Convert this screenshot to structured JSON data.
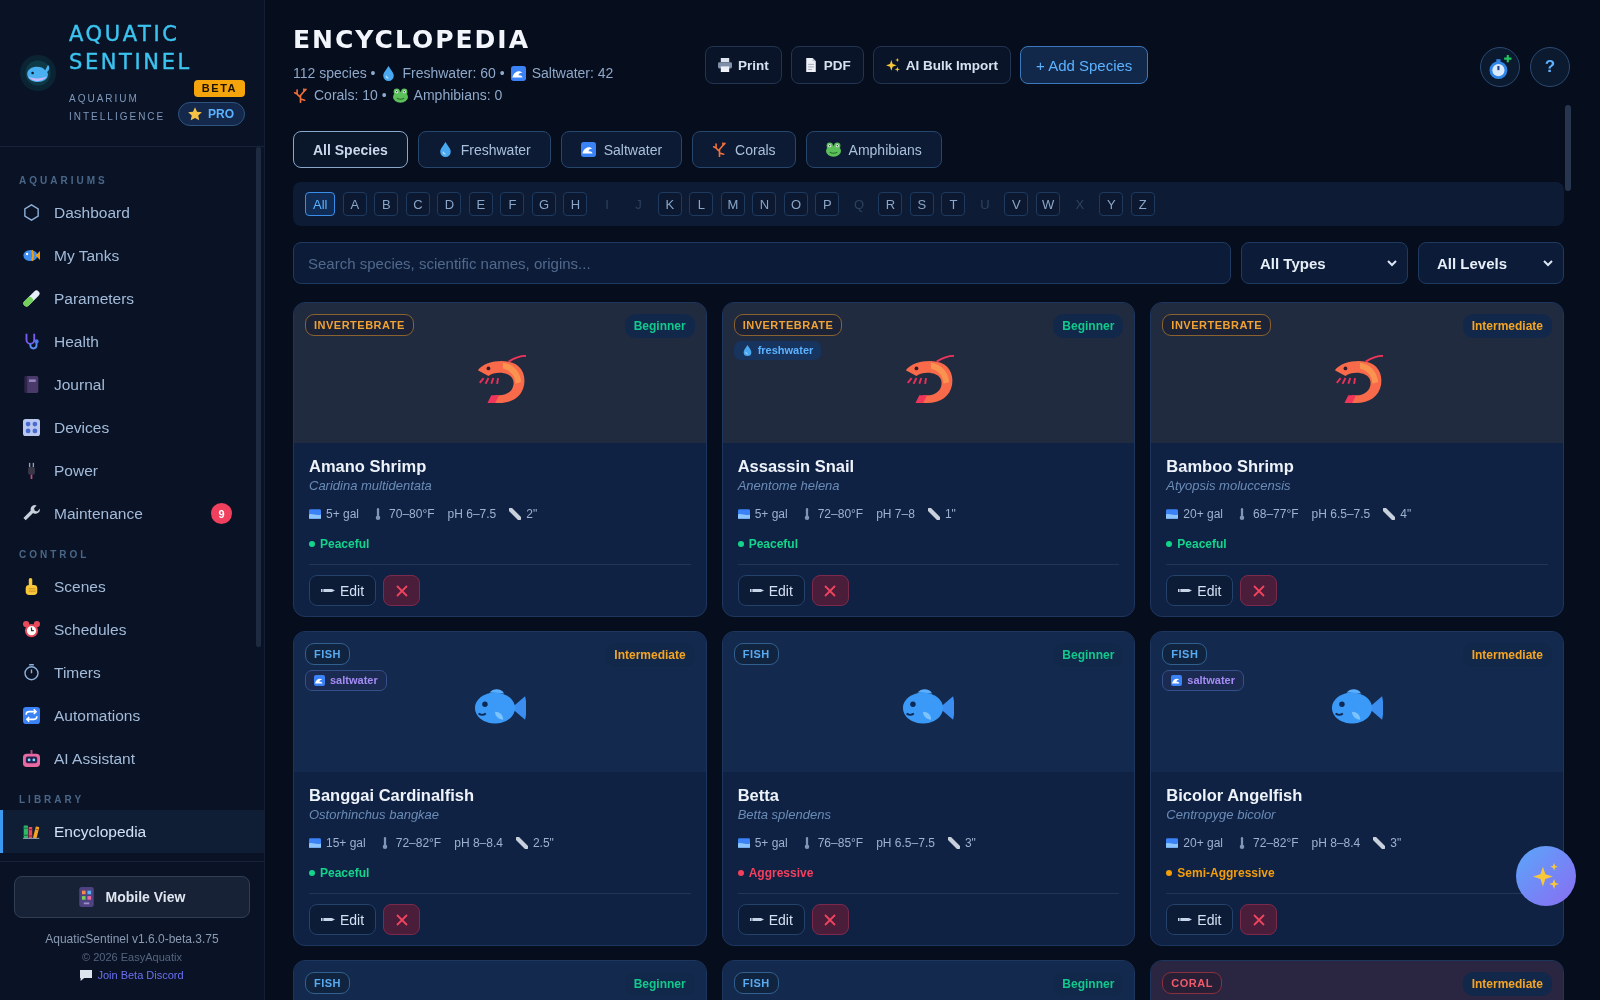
{
  "sidebar": {
    "brand": {
      "title": "AQUATIC SENTINEL",
      "subtitle": "AQUARIUM INTELLIGENCE",
      "beta_badge": "BETA",
      "pro_badge": "PRO"
    },
    "sections": [
      {
        "label": "AQUARIUMS",
        "items": [
          {
            "label": "Dashboard",
            "selected": false
          },
          {
            "label": "My Tanks",
            "selected": false
          },
          {
            "label": "Parameters",
            "selected": false
          },
          {
            "label": "Health",
            "selected": false
          },
          {
            "label": "Journal",
            "selected": false
          },
          {
            "label": "Devices",
            "selected": false
          },
          {
            "label": "Power",
            "selected": false
          },
          {
            "label": "Maintenance",
            "selected": false,
            "badge": "9"
          }
        ]
      },
      {
        "label": "CONTROL",
        "items": [
          {
            "label": "Scenes",
            "selected": false
          },
          {
            "label": "Schedules",
            "selected": false
          },
          {
            "label": "Timers",
            "selected": false
          },
          {
            "label": "Automations",
            "selected": false
          },
          {
            "label": "AI Assistant",
            "selected": false
          }
        ]
      },
      {
        "label": "LIBRARY",
        "items": [
          {
            "label": "Encyclopedia",
            "selected": true
          }
        ]
      }
    ],
    "mobile_view_button": "Mobile View",
    "version": "AquaticSentinel v1.6.0-beta.3.75",
    "copyright": "© 2026 EasyAquatix",
    "discord_link": "Join Beta Discord"
  },
  "header": {
    "title": "ENCYCLOPEDIA",
    "stats": [
      [
        {
          "kind": "total",
          "text": "112 species •"
        },
        {
          "kind": "freshwater",
          "text": "Freshwater: 60 •"
        },
        {
          "kind": "saltwater",
          "text": "Saltwater: 42"
        }
      ],
      [
        {
          "kind": "coral",
          "text": "Corals: 10 •"
        },
        {
          "kind": "amphibian",
          "text": "Amphibians: 0"
        }
      ]
    ],
    "actions": [
      {
        "kind": "print",
        "label": "Print"
      },
      {
        "kind": "pdf",
        "label": "PDF"
      },
      {
        "kind": "ai",
        "label": "AI Bulk Import"
      },
      {
        "kind": "add",
        "label": "+ Add Species"
      }
    ],
    "help_button": "?"
  },
  "category_tabs": [
    {
      "kind": "all",
      "label": "All Species",
      "selected": true
    },
    {
      "kind": "freshwater",
      "label": "Freshwater",
      "selected": false
    },
    {
      "kind": "saltwater",
      "label": "Saltwater",
      "selected": false
    },
    {
      "kind": "coral",
      "label": "Corals",
      "selected": false
    },
    {
      "kind": "amphibian",
      "label": "Amphibians",
      "selected": false
    }
  ],
  "alphabet": [
    {
      "label": "All",
      "selected": true,
      "disabled": false
    },
    {
      "label": "A",
      "selected": false,
      "disabled": false
    },
    {
      "label": "B",
      "selected": false,
      "disabled": false
    },
    {
      "label": "C",
      "selected": false,
      "disabled": false
    },
    {
      "label": "D",
      "selected": false,
      "disabled": false
    },
    {
      "label": "E",
      "selected": false,
      "disabled": false
    },
    {
      "label": "F",
      "selected": false,
      "disabled": false
    },
    {
      "label": "G",
      "selected": false,
      "disabled": false
    },
    {
      "label": "H",
      "selected": false,
      "disabled": false
    },
    {
      "label": "I",
      "selected": false,
      "disabled": true
    },
    {
      "label": "J",
      "selected": false,
      "disabled": true
    },
    {
      "label": "K",
      "selected": false,
      "disabled": false
    },
    {
      "label": "L",
      "selected": false,
      "disabled": false
    },
    {
      "label": "M",
      "selected": false,
      "disabled": false
    },
    {
      "label": "N",
      "selected": false,
      "disabled": false
    },
    {
      "label": "O",
      "selected": false,
      "disabled": false
    },
    {
      "label": "P",
      "selected": false,
      "disabled": false
    },
    {
      "label": "Q",
      "selected": false,
      "disabled": true
    },
    {
      "label": "R",
      "selected": false,
      "disabled": false
    },
    {
      "label": "S",
      "selected": false,
      "disabled": false
    },
    {
      "label": "T",
      "selected": false,
      "disabled": false
    },
    {
      "label": "U",
      "selected": false,
      "disabled": true
    },
    {
      "label": "V",
      "selected": false,
      "disabled": false
    },
    {
      "label": "W",
      "selected": false,
      "disabled": false
    },
    {
      "label": "X",
      "selected": false,
      "disabled": true
    },
    {
      "label": "Y",
      "selected": false,
      "disabled": false
    },
    {
      "label": "Z",
      "selected": false,
      "disabled": false
    }
  ],
  "search": {
    "placeholder": "Search species, scientific names, origins..."
  },
  "filters": [
    {
      "value": "All Types"
    },
    {
      "value": "All Levels"
    }
  ],
  "cards": [
    {
      "kind": "invertebrate",
      "type": "INVERTEBRATE",
      "difficulty": {
        "label": "Beginner",
        "color": "#12c98c"
      },
      "name": "Amano Shrimp",
      "scientific": "Caridina multidentata",
      "stats": [
        {
          "kind": "tank",
          "text": "5+ gal"
        },
        {
          "kind": "temperature",
          "text": "70–80°F"
        },
        {
          "kind": "ph",
          "text": "pH 6–7.5"
        },
        {
          "kind": "size",
          "text": "2\""
        }
      ],
      "temperament": {
        "label": "Peaceful",
        "color": "#14d48c"
      },
      "edit_button": "Edit"
    },
    {
      "kind": "invertebrate",
      "type": "INVERTEBRATE",
      "water": {
        "kind": "freshwater",
        "label": "freshwater"
      },
      "difficulty": {
        "label": "Beginner",
        "color": "#12c98c"
      },
      "name": "Assassin Snail",
      "scientific": "Anentome helena",
      "stats": [
        {
          "kind": "tank",
          "text": "5+ gal"
        },
        {
          "kind": "temperature",
          "text": "72–80°F"
        },
        {
          "kind": "ph",
          "text": "pH 7–8"
        },
        {
          "kind": "size",
          "text": "1\""
        }
      ],
      "temperament": {
        "label": "Peaceful",
        "color": "#14d48c"
      },
      "edit_button": "Edit"
    },
    {
      "kind": "invertebrate",
      "type": "INVERTEBRATE",
      "difficulty": {
        "label": "Intermediate",
        "color": "#f5a524"
      },
      "name": "Bamboo Shrimp",
      "scientific": "Atyopsis moluccensis",
      "stats": [
        {
          "kind": "tank",
          "text": "20+ gal"
        },
        {
          "kind": "temperature",
          "text": "68–77°F"
        },
        {
          "kind": "ph",
          "text": "pH 6.5–7.5"
        },
        {
          "kind": "size",
          "text": "4\""
        }
      ],
      "temperament": {
        "label": "Peaceful",
        "color": "#14d48c"
      },
      "edit_button": "Edit"
    },
    {
      "kind": "fish",
      "type": "FISH",
      "water": {
        "kind": "saltwater",
        "label": "saltwater"
      },
      "difficulty": {
        "label": "Intermediate",
        "color": "#f5a524"
      },
      "name": "Banggai Cardinalfish",
      "scientific": "Ostorhinchus bangkae",
      "stats": [
        {
          "kind": "tank",
          "text": "15+ gal"
        },
        {
          "kind": "temperature",
          "text": "72–82°F"
        },
        {
          "kind": "ph",
          "text": "pH 8–8.4"
        },
        {
          "kind": "size",
          "text": "2.5\""
        }
      ],
      "temperament": {
        "label": "Peaceful",
        "color": "#14d48c"
      },
      "edit_button": "Edit"
    },
    {
      "kind": "fish",
      "type": "FISH",
      "difficulty": {
        "label": "Beginner",
        "color": "#12c98c"
      },
      "name": "Betta",
      "scientific": "Betta splendens",
      "stats": [
        {
          "kind": "tank",
          "text": "5+ gal"
        },
        {
          "kind": "temperature",
          "text": "76–85°F"
        },
        {
          "kind": "ph",
          "text": "pH 6.5–7.5"
        },
        {
          "kind": "size",
          "text": "3\""
        }
      ],
      "temperament": {
        "label": "Aggressive",
        "color": "#f43f5e"
      },
      "edit_button": "Edit"
    },
    {
      "kind": "fish",
      "type": "FISH",
      "water": {
        "kind": "saltwater",
        "label": "saltwater"
      },
      "difficulty": {
        "label": "Intermediate",
        "color": "#f5a524"
      },
      "name": "Bicolor Angelfish",
      "scientific": "Centropyge bicolor",
      "stats": [
        {
          "kind": "tank",
          "text": "20+ gal"
        },
        {
          "kind": "temperature",
          "text": "72–82°F"
        },
        {
          "kind": "ph",
          "text": "pH 8–8.4"
        },
        {
          "kind": "size",
          "text": "3\""
        }
      ],
      "temperament": {
        "label": "Semi-Aggressive",
        "color": "#f59e0b"
      },
      "edit_button": "Edit"
    },
    {
      "kind": "fish",
      "type": "FISH",
      "difficulty": {
        "label": "Beginner",
        "color": "#12c98c"
      }
    },
    {
      "kind": "fish",
      "type": "FISH",
      "difficulty": {
        "label": "Beginner",
        "color": "#12c98c"
      }
    },
    {
      "kind": "coral",
      "type": "CORAL",
      "difficulty": {
        "label": "Intermediate",
        "color": "#f5a524"
      }
    }
  ]
}
